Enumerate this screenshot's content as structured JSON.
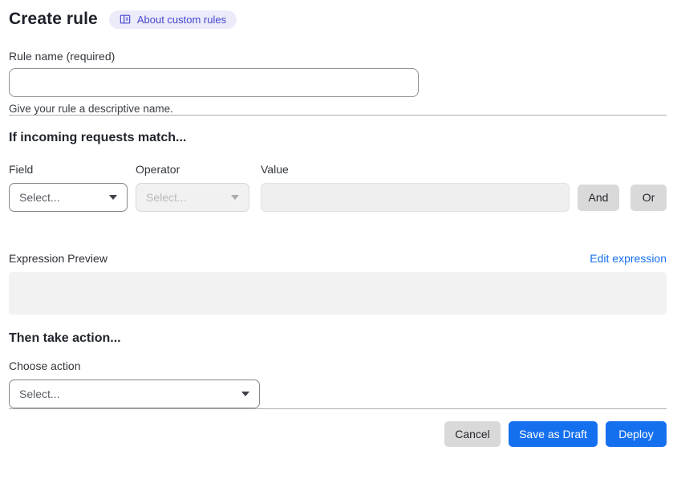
{
  "page": {
    "title": "Create rule",
    "about_badge_label": "About custom rules"
  },
  "rule_name": {
    "label": "Rule name (required)",
    "value": "",
    "helper": "Give your rule a descriptive name."
  },
  "match": {
    "heading": "If incoming requests match...",
    "field_label": "Field",
    "operator_label": "Operator",
    "value_label": "Value",
    "field_placeholder": "Select...",
    "field_disabled": false,
    "operator_placeholder": "Select...",
    "operator_disabled": true,
    "value_text": "",
    "value_disabled": true,
    "and_label": "And",
    "or_label": "Or"
  },
  "expression": {
    "label": "Expression Preview",
    "edit_link": "Edit expression",
    "preview_text": ""
  },
  "action": {
    "heading": "Then take action...",
    "label": "Choose action",
    "select_placeholder": "Select..."
  },
  "footer": {
    "cancel": "Cancel",
    "save_draft": "Save as Draft",
    "deploy": "Deploy"
  },
  "colors": {
    "primary_blue": "#1570ef",
    "link_blue": "#1570ef",
    "badge_bg": "#ecebfa",
    "badge_text": "#4545cf",
    "gray_button_bg": "#d9d9d9",
    "disabled_bg": "#f1f1f1",
    "preview_box_bg": "#f2f2f2",
    "divider": "#aeaeae"
  }
}
